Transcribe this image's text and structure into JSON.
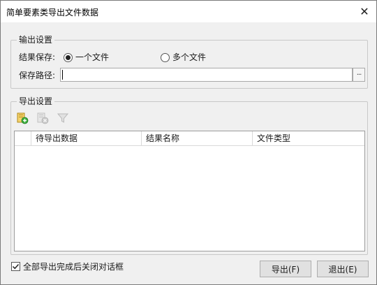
{
  "window": {
    "title": "简单要素类导出文件数据",
    "close_glyph": "✕"
  },
  "output_settings": {
    "group_title": "输出设置",
    "save_label": "结果保存:",
    "radio_one_file": "一个文件",
    "radio_multi_file": "多个文件",
    "selected": "一个文件",
    "path_label": "保存路径:",
    "path_value": "",
    "browse_label": "···"
  },
  "export_settings": {
    "group_title": "导出设置",
    "toolbar": {
      "add_icon": "add-data-icon",
      "remove_icon": "remove-data-icon",
      "filter_icon": "filter-icon"
    },
    "table": {
      "columns": [
        "待导出数据",
        "结果名称",
        "文件类型"
      ],
      "rows": []
    }
  },
  "footer": {
    "close_checkbox_label": "全部导出完成后关闭对话框",
    "close_checkbox_checked": true,
    "export_button": "导出(F)",
    "exit_button": "退出(E)"
  },
  "colors": {
    "window_bg": "#f0f0f0",
    "titlebar_bg": "#ffffff",
    "button_bg": "#e1e1e1"
  }
}
